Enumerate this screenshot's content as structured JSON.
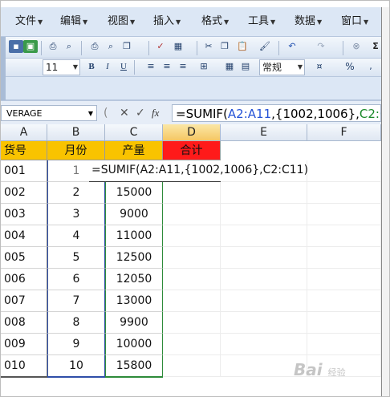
{
  "menu": {
    "items": [
      "文件",
      "编辑",
      "视图",
      "插入",
      "格式",
      "工具",
      "数据",
      "窗口"
    ]
  },
  "toolbar": {
    "font_size": "11",
    "bold": "B",
    "italic": "I",
    "underline": "U",
    "number_format": "常规",
    "percent": "%"
  },
  "formula_bar": {
    "name_box": "VERAGE",
    "fx": "fx",
    "formula_parts": [
      "=SUMIF(",
      "A2:A11",
      ",{1002,1006},",
      "C2:C11",
      ")"
    ]
  },
  "grid": {
    "columns": [
      "A",
      "B",
      "C",
      "D",
      "E",
      "F"
    ],
    "header_row": [
      "货号",
      "月份",
      "产量",
      "合计"
    ],
    "rows": [
      {
        "a": "001",
        "b": "1",
        "c": ""
      },
      {
        "a": "002",
        "b": "2",
        "c": "15000"
      },
      {
        "a": "003",
        "b": "3",
        "c": "9000"
      },
      {
        "a": "004",
        "b": "4",
        "c": "11000"
      },
      {
        "a": "005",
        "b": "5",
        "c": "12500"
      },
      {
        "a": "006",
        "b": "6",
        "c": "12050"
      },
      {
        "a": "007",
        "b": "7",
        "c": "13000"
      },
      {
        "a": "008",
        "b": "8",
        "c": "9900"
      },
      {
        "a": "009",
        "b": "9",
        "c": "10000"
      },
      {
        "a": "010",
        "b": "10",
        "c": "15800"
      }
    ],
    "edit_text": "=SUMIF(A2:A11,{1002,1006},C2:C11)"
  },
  "watermark": "Bai",
  "watermark_sub": "经验",
  "colors": {
    "header_fill": "#f9c300",
    "total_fill": "#ff1a1a",
    "ref_blue": "#2452d6",
    "ref_green": "#1b8a2a"
  }
}
